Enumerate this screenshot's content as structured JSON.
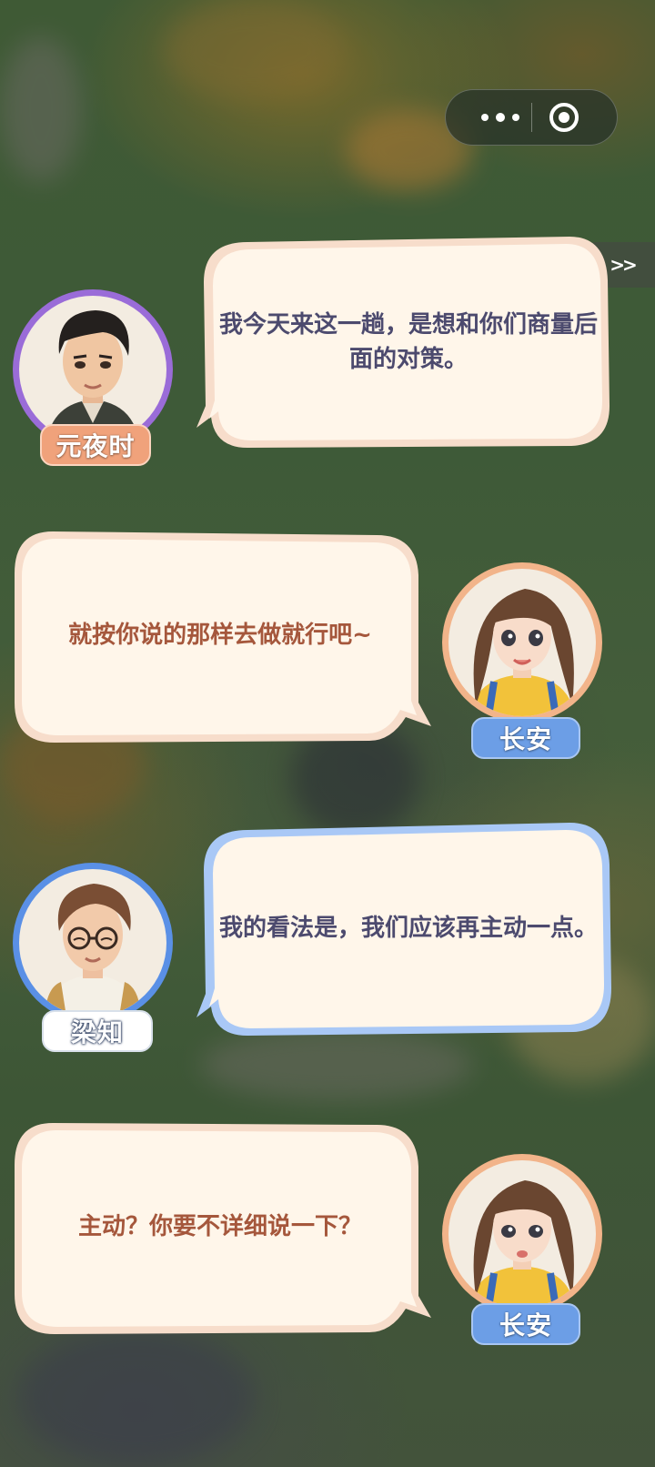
{
  "top_controls": {
    "more_icon": "more-dots-icon",
    "close_icon": "target-circle-icon"
  },
  "skip_label": ">>",
  "dialogue": [
    {
      "speaker": "元夜时",
      "text": "我今天来这一趟，是想和你们商量后面的对策。",
      "side": "left",
      "text_color": "#4c4a6e",
      "tag_color": "#f0a27b"
    },
    {
      "speaker": "长安",
      "text": "就按你说的那样去做就行吧~",
      "side": "right",
      "text_color": "#a5573c",
      "tag_color": "#6c9ee6"
    },
    {
      "speaker": "梁知",
      "text": "我的看法是，我们应该再主动一点。",
      "side": "left",
      "text_color": "#4c4a6e",
      "tag_color": "#ffffff"
    },
    {
      "speaker": "长安",
      "text": "主动？你要不详细说一下？",
      "side": "right",
      "text_color": "#a5573c",
      "tag_color": "#6c9ee6"
    }
  ]
}
